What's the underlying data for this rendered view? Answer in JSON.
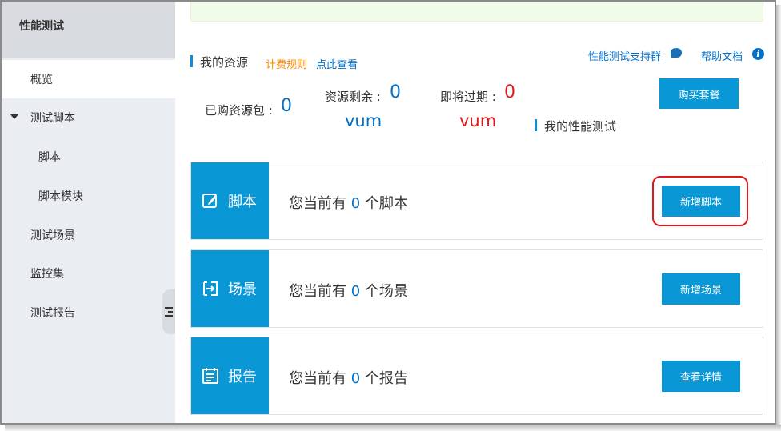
{
  "sidebar": {
    "title": "性能测试",
    "items": [
      {
        "label": "概览"
      },
      {
        "label": "测试脚本"
      },
      {
        "label": "脚本"
      },
      {
        "label": "脚本模块"
      },
      {
        "label": "测试场景"
      },
      {
        "label": "监控集"
      },
      {
        "label": "测试报告"
      }
    ]
  },
  "resources": {
    "title": "我的资源",
    "billing_rule": "计费规则",
    "view_link": "点此查看",
    "support_group": "性能测试支持群",
    "help_doc": "帮助文档",
    "purchased_label": "已购资源包 :",
    "purchased_value": "0",
    "remaining_label": "资源剩余 :",
    "remaining_value": "0",
    "remaining_unit": "vum",
    "expiring_label": "即将过期 :",
    "expiring_value": "0",
    "expiring_unit": "vum",
    "buy_button": "购买套餐",
    "my_tests_title": "我的性能测试"
  },
  "cards": [
    {
      "head": "脚本",
      "prefix": "您当前有",
      "count": "0",
      "suffix": "个脚本",
      "button": "新增脚本"
    },
    {
      "head": "场景",
      "prefix": "您当前有",
      "count": "0",
      "suffix": "个场景",
      "button": "新增场景"
    },
    {
      "head": "报告",
      "prefix": "您当前有",
      "count": "0",
      "suffix": "个报告",
      "button": "查看详情"
    }
  ],
  "colors": {
    "accent": "#0a97d6",
    "link": "#0570c8",
    "warning": "#e0191b",
    "billing": "#ff8a00"
  }
}
